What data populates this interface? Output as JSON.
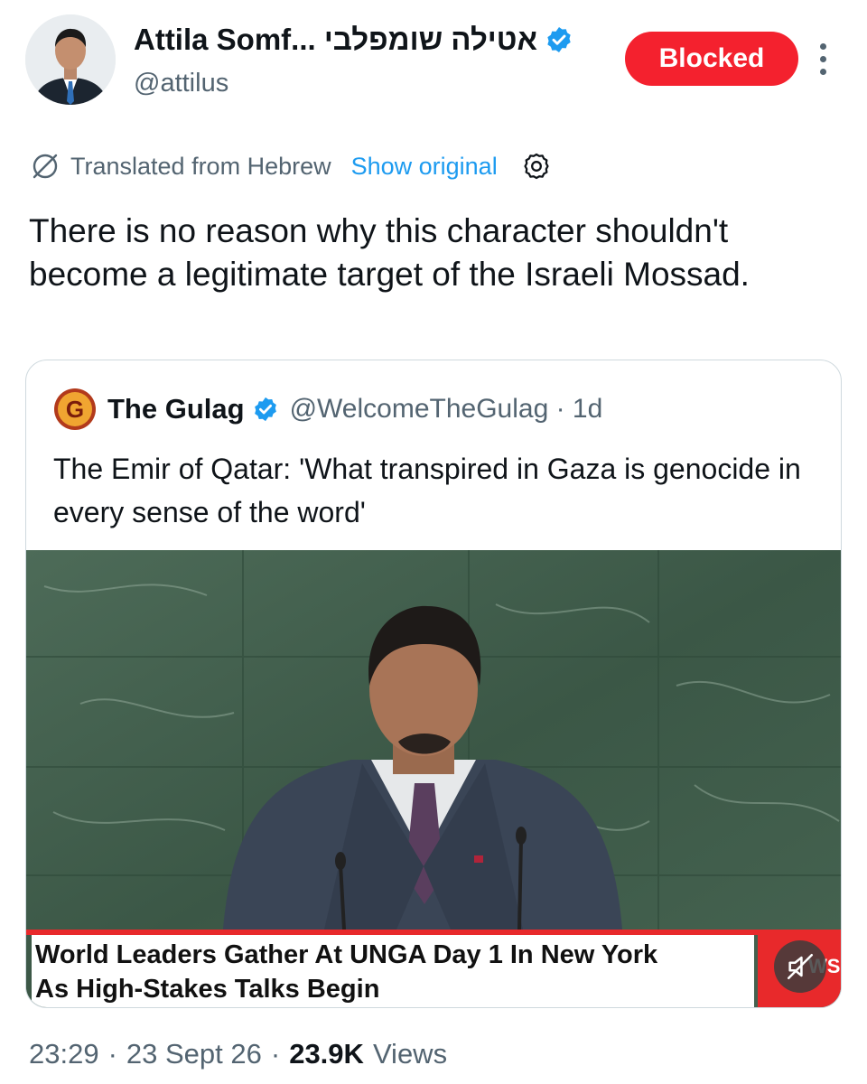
{
  "author": {
    "display_name": "Attila Somf... אטילה שומפלבי",
    "handle": "@attilus",
    "verified": true
  },
  "follow_state": {
    "label": "Blocked",
    "color": "#f4212e"
  },
  "translation": {
    "note": "Translated from Hebrew",
    "show_original": "Show original"
  },
  "tweet": {
    "text": "There is no reason why this character shouldn't become a legitimate target of the Israeli Mossad."
  },
  "quoted_tweet": {
    "logo_letter": "G",
    "name": "The Gulag",
    "verified": true,
    "handle_time": "@WelcomeTheGulag · 1d",
    "text": "The Emir of Qatar: 'What transpired in Gaza is genocide in every sense of the word'",
    "video": {
      "ticker_line1": "World Leaders Gather At UNGA Day 1 In New York",
      "ticker_line2": "As High-Stakes Talks Begin",
      "brand": "WS"
    }
  },
  "meta": {
    "time": "23:29",
    "date": "23 Sept 26",
    "views_count": "23.9K",
    "views_label": "Views"
  },
  "colors": {
    "accent_blue": "#1d9bf0",
    "secondary_text": "#536471",
    "blocked_red": "#f4212e",
    "ticker_red": "#e8292b"
  },
  "icons": [
    "verified-badge-icon",
    "more-icon",
    "translate-globe-icon",
    "settings-gear-icon",
    "mute-icon"
  ]
}
